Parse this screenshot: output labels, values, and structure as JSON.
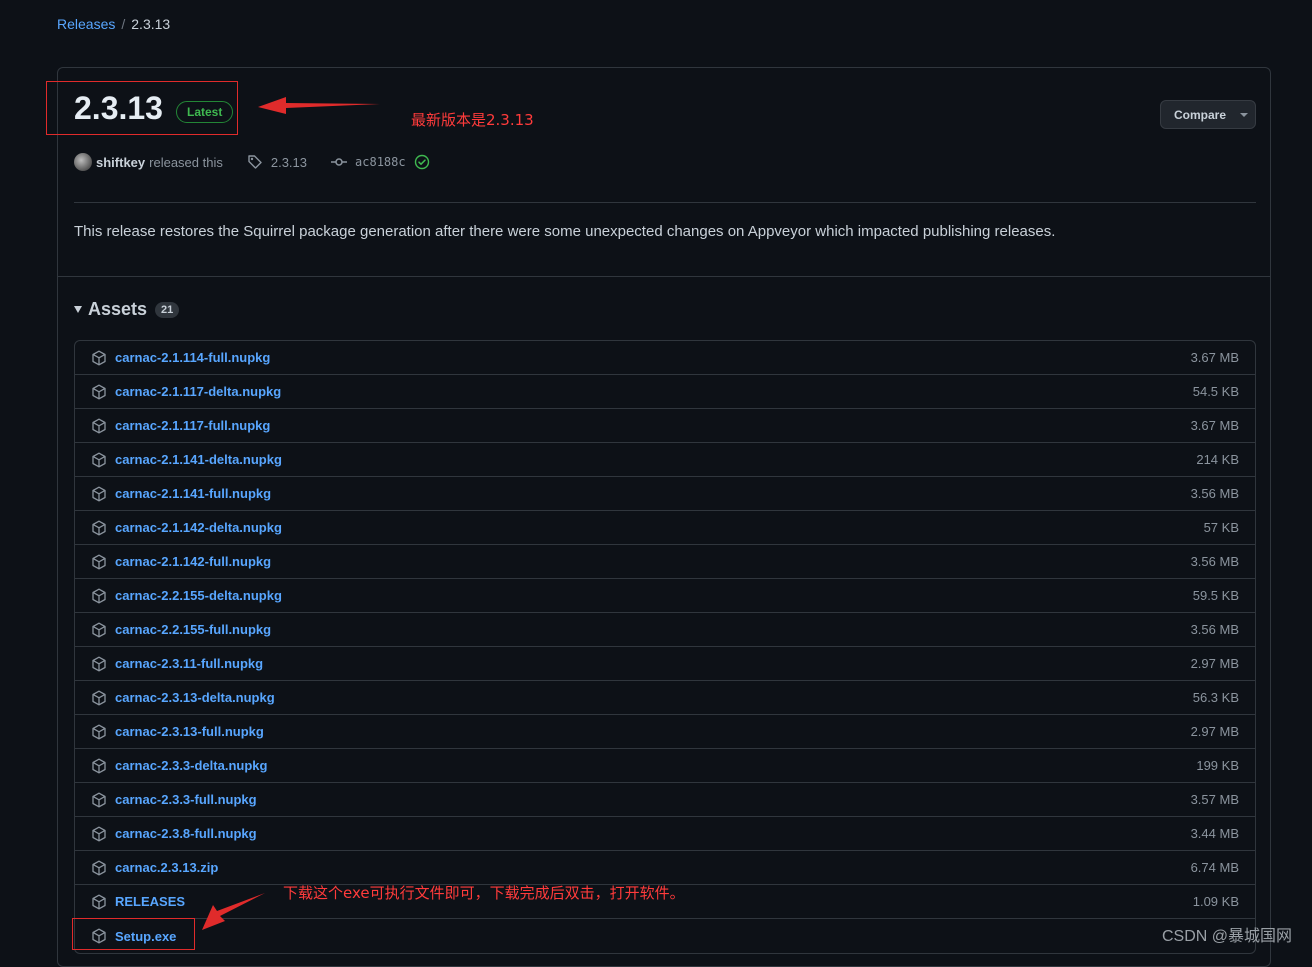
{
  "breadcrumb": {
    "parent": "Releases",
    "separator": "/",
    "current": "2.3.13"
  },
  "release": {
    "title": "2.3.13",
    "badge": "Latest",
    "compare_label": "Compare",
    "author": "shiftkey",
    "action": "released this",
    "tag": "2.3.13",
    "commit": "ac8188c",
    "description": "This release restores the Squirrel package generation after there were some unexpected changes on Appveyor which impacted publishing releases."
  },
  "assets": {
    "heading": "Assets",
    "count": "21",
    "items": [
      {
        "name": "carnac-2.1.114-full.nupkg",
        "size": "3.67 MB"
      },
      {
        "name": "carnac-2.1.117-delta.nupkg",
        "size": "54.5 KB"
      },
      {
        "name": "carnac-2.1.117-full.nupkg",
        "size": "3.67 MB"
      },
      {
        "name": "carnac-2.1.141-delta.nupkg",
        "size": "214 KB"
      },
      {
        "name": "carnac-2.1.141-full.nupkg",
        "size": "3.56 MB"
      },
      {
        "name": "carnac-2.1.142-delta.nupkg",
        "size": "57 KB"
      },
      {
        "name": "carnac-2.1.142-full.nupkg",
        "size": "3.56 MB"
      },
      {
        "name": "carnac-2.2.155-delta.nupkg",
        "size": "59.5 KB"
      },
      {
        "name": "carnac-2.2.155-full.nupkg",
        "size": "3.56 MB"
      },
      {
        "name": "carnac-2.3.11-full.nupkg",
        "size": "2.97 MB"
      },
      {
        "name": "carnac-2.3.13-delta.nupkg",
        "size": "56.3 KB"
      },
      {
        "name": "carnac-2.3.13-full.nupkg",
        "size": "2.97 MB"
      },
      {
        "name": "carnac-2.3.3-delta.nupkg",
        "size": "199 KB"
      },
      {
        "name": "carnac-2.3.3-full.nupkg",
        "size": "3.57 MB"
      },
      {
        "name": "carnac-2.3.8-full.nupkg",
        "size": "3.44 MB"
      },
      {
        "name": "carnac.2.3.13.zip",
        "size": "6.74 MB"
      },
      {
        "name": "RELEASES",
        "size": "1.09 KB"
      },
      {
        "name": "Setup.exe",
        "size": ""
      }
    ]
  },
  "annotations": {
    "latest_note": "最新版本是2.3.13",
    "setup_note": "下载这个exe可执行文件即可，下载完成后双击，打开软件。",
    "color": "#e02b2b"
  },
  "watermark": "CSDN @暴城国网",
  "colors": {
    "link": "#58a6ff",
    "background": "#0d1117",
    "latest_badge": "#3fb950"
  }
}
